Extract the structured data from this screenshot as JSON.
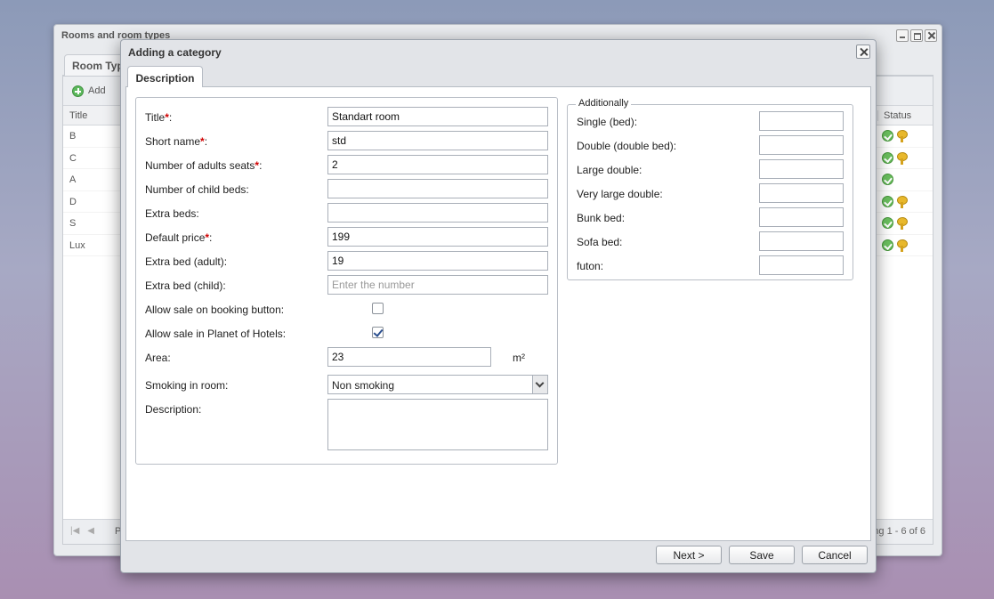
{
  "background_window": {
    "title": "Rooms and room types",
    "tab": "Room Typ",
    "toolbar_add": "Add",
    "columns": {
      "title": "Title",
      "status": "Status"
    },
    "rows": [
      {
        "title": "B",
        "key": true
      },
      {
        "title": "C",
        "key": true
      },
      {
        "title": "A",
        "key": false
      },
      {
        "title": "D",
        "key": true
      },
      {
        "title": "S",
        "key": true
      },
      {
        "title": "Lux",
        "key": true
      }
    ],
    "footer_page": "P",
    "footer_info": "ng 1 - 6 of 6"
  },
  "dialog": {
    "title": "Adding a category",
    "tab": "Description",
    "fields": {
      "title": {
        "label": "Title",
        "value": "Standart room"
      },
      "short_name": {
        "label": "Short name",
        "value": "std"
      },
      "adults": {
        "label": "Number of adults seats",
        "value": "2"
      },
      "child_beds": {
        "label": "Number of child beds:",
        "value": ""
      },
      "extra_beds": {
        "label": "Extra beds:",
        "value": ""
      },
      "default_price": {
        "label": "Default price",
        "value": "199"
      },
      "extra_bed_adult": {
        "label": "Extra bed (adult):",
        "value": "19"
      },
      "extra_bed_child": {
        "label": "Extra bed (child):",
        "value": "",
        "placeholder": "Enter the number"
      },
      "allow_booking_button": {
        "label": "Allow sale on booking button:",
        "checked": false
      },
      "allow_planet": {
        "label": "Allow sale in Planet of Hotels:",
        "checked": true
      },
      "area": {
        "label": "Area:",
        "value": "23",
        "unit": "m²"
      },
      "smoking": {
        "label": "Smoking in room:",
        "value": "Non smoking"
      },
      "description": {
        "label": "Description:",
        "value": ""
      }
    },
    "additionally": {
      "legend": "Additionally",
      "items": [
        {
          "label": "Single (bed):",
          "value": ""
        },
        {
          "label": "Double (double bed):",
          "value": ""
        },
        {
          "label": "Large double:",
          "value": ""
        },
        {
          "label": "Very large double:",
          "value": ""
        },
        {
          "label": "Bunk bed:",
          "value": ""
        },
        {
          "label": "Sofa bed:",
          "value": ""
        },
        {
          "label": "futon:",
          "value": ""
        }
      ]
    },
    "buttons": {
      "next": "Next >",
      "save": "Save",
      "cancel": "Cancel"
    }
  }
}
